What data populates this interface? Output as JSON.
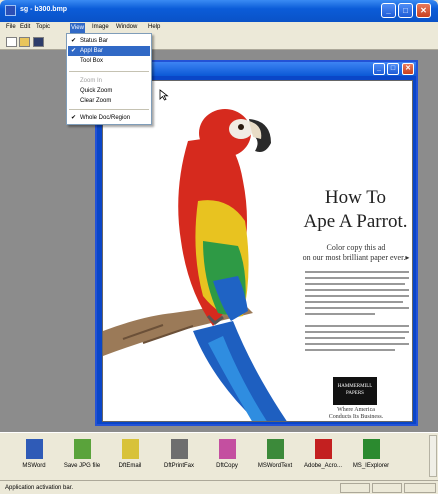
{
  "window": {
    "title": "sg - b300.bmp",
    "controls": {
      "minimize": "_",
      "maximize": "□",
      "close": "✕"
    }
  },
  "menubar": {
    "items": [
      "File",
      "Edit",
      "Topic",
      "View",
      "Image",
      "Window",
      "Help"
    ],
    "active": "View"
  },
  "view_menu": {
    "items": [
      {
        "label": "Status Bar",
        "checked": true,
        "enabled": true,
        "highlighted": false
      },
      {
        "label": "Appl Bar",
        "checked": true,
        "enabled": true,
        "highlighted": true
      },
      {
        "label": "Tool Box",
        "checked": false,
        "enabled": true,
        "highlighted": false
      },
      {
        "label": "Zoom In",
        "checked": false,
        "enabled": false,
        "highlighted": false
      },
      {
        "label": "Quick Zoom",
        "checked": false,
        "enabled": true,
        "highlighted": false
      },
      {
        "label": "Clear Zoom",
        "checked": false,
        "enabled": true,
        "highlighted": false
      },
      {
        "label": "Whole Doc/Region",
        "checked": true,
        "enabled": true,
        "highlighted": false
      }
    ]
  },
  "document": {
    "headline_1": "How To",
    "headline_2": "Ape A Parrot.",
    "sub_1": "Color copy this ad",
    "sub_2": "on our most brilliant paper ever.▸",
    "logo": "HAMMERMILL PAPERS",
    "tagline_1": "Where America",
    "tagline_2": "Conducts Its Business."
  },
  "appbar": {
    "apps": [
      {
        "label": "MSWord",
        "icon": "msword-icon",
        "color": "#2F5BB7"
      },
      {
        "label": "Save JPG file",
        "icon": "save-jpg-icon",
        "color": "#5AA33B"
      },
      {
        "label": "DftEmail",
        "icon": "email-icon",
        "color": "#D8C23A"
      },
      {
        "label": "DftPrintFax",
        "icon": "printer-icon",
        "color": "#6E6E6E"
      },
      {
        "label": "DftCopy",
        "icon": "copier-icon",
        "color": "#C44FA0"
      },
      {
        "label": "MSWordText",
        "icon": "msword-text-icon",
        "color": "#3C8A3A"
      },
      {
        "label": "Adobe_Acro...",
        "icon": "acrobat-icon",
        "color": "#C32020"
      },
      {
        "label": "MS_IExplorer",
        "icon": "ie-icon",
        "color": "#2B8A2F"
      }
    ]
  },
  "status": {
    "text": "Application activation bar."
  }
}
